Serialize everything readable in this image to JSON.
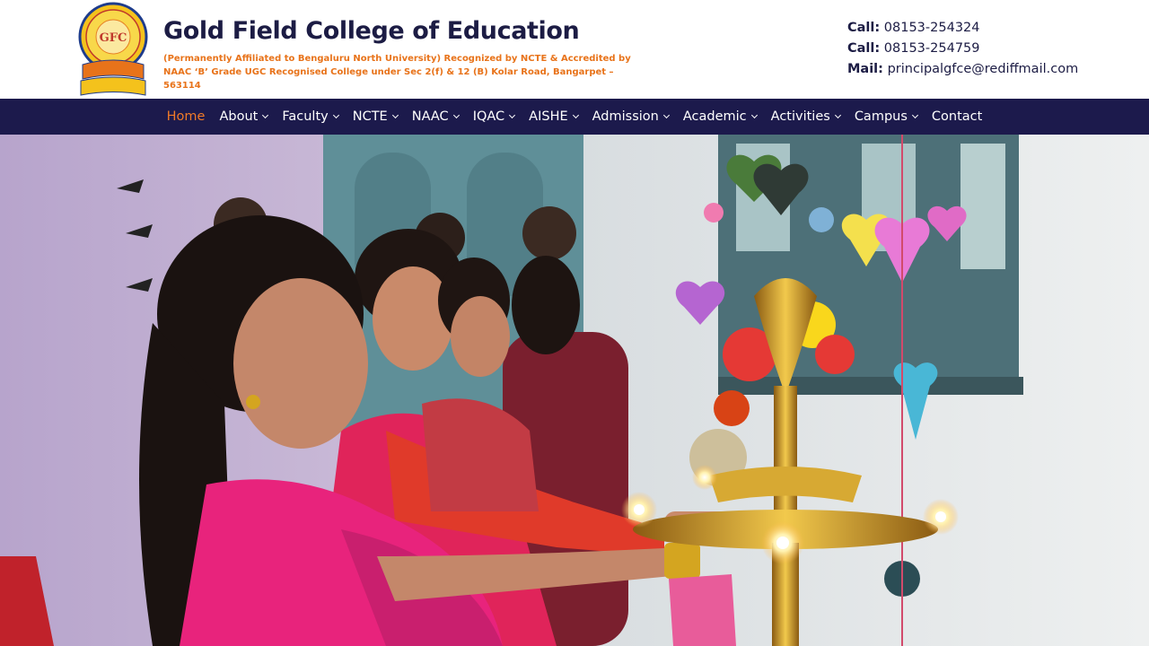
{
  "header": {
    "title": "Gold Field College of Education",
    "subtitle_line1": "(Permanently Affiliated to Bengaluru North University) Recognized by NCTE & Accredited by",
    "subtitle_line2": "NAAC ‘B’ Grade UGC Recognised College under Sec 2(f) & 12 (B) Kolar Road, Bangarpet – 563114",
    "logo": {
      "top_text": "MANI GNANENA SADHAKAM",
      "monogram": "GFC",
      "ribbon_line1": "GOLD FIELD COLLEGE OF EDUCATION",
      "ribbon_line2": "Kolar Road, Bangarpet"
    }
  },
  "contact": {
    "call1_label": "Call:",
    "call1_value": "08153-254324",
    "call2_label": "Call:",
    "call2_value": "08153-254759",
    "mail_label": "Mail:",
    "mail_value": "principalgfce@rediffmail.com"
  },
  "nav": {
    "items": [
      {
        "label": "Home",
        "dropdown": false,
        "active": true
      },
      {
        "label": "About",
        "dropdown": true
      },
      {
        "label": "Faculty",
        "dropdown": true
      },
      {
        "label": "NCTE",
        "dropdown": true
      },
      {
        "label": "NAAC",
        "dropdown": true
      },
      {
        "label": "IQAC",
        "dropdown": true
      },
      {
        "label": "AISHE",
        "dropdown": true
      },
      {
        "label": "Admission",
        "dropdown": true
      },
      {
        "label": "Academic",
        "dropdown": true
      },
      {
        "label": "Activities",
        "dropdown": true
      },
      {
        "label": "Campus",
        "dropdown": true
      },
      {
        "label": "Contact",
        "dropdown": false
      }
    ]
  },
  "colors": {
    "nav_bg": "#1c1a4c",
    "active": "#f07a28",
    "title": "#1c1c44",
    "subtitle": "#e8731a"
  }
}
